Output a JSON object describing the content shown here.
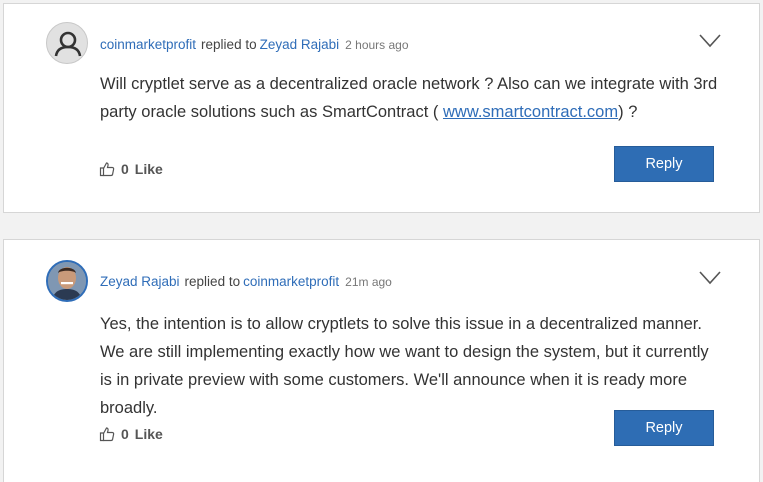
{
  "comments": [
    {
      "author": "coinmarketprofit",
      "replied_text": "replied to",
      "reply_to": "Zeyad Rajabi",
      "time": "2 hours ago",
      "body_before_link": "Will cryptlet serve as a decentralized oracle network ? Also can we integrate with 3rd party oracle solutions such as SmartContract ( ",
      "link": "www.smartcontract.com",
      "body_after_link": ") ?",
      "like_count": "0",
      "like_label": "Like",
      "reply_label": "Reply",
      "avatar": "default-user-icon"
    },
    {
      "author": "Zeyad Rajabi",
      "replied_text": "replied to",
      "reply_to": "coinmarketprofit",
      "time": "21m ago",
      "body": "Yes, the intention is to allow cryptlets to solve this issue in a decentralized manner. We are still implementing exactly how we want to design the system, but it currently is in private preview with some customers. We'll announce when it is ready more broadly.",
      "like_count": "0",
      "like_label": "Like",
      "reply_label": "Reply",
      "avatar": "user-photo"
    }
  ],
  "colors": {
    "accent": "#2e6db4",
    "link": "#2f6db8",
    "background": "#f2f2f2"
  }
}
